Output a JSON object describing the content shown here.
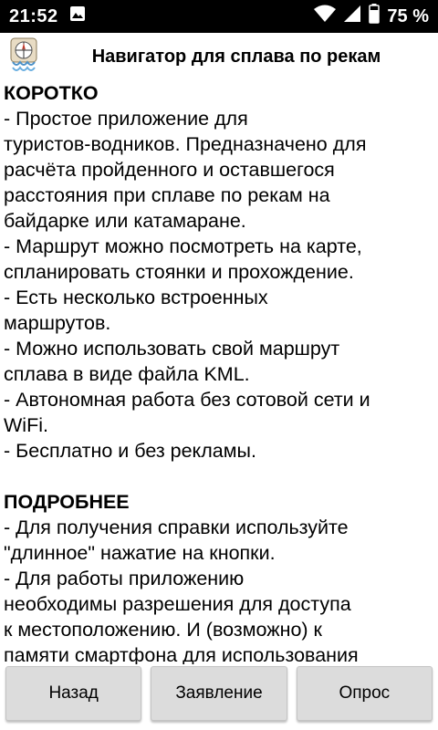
{
  "status_bar": {
    "time": "21:52",
    "battery_percent": "75 %",
    "icons": [
      "image-icon",
      "wifi-icon",
      "signal-icon",
      "battery-icon"
    ]
  },
  "header": {
    "title": "Навигатор для сплава по рекам",
    "logo": "app-logo-icon"
  },
  "content": {
    "short_title": "КОРОТКО",
    "short_lines": [
      "- Простое приложение для",
      "туристов-водников. Предназначено для",
      "расчёта пройденного и оставшегося",
      "расстояния при сплаве по рекам на",
      "байдарке или катамаране.",
      "- Маршрут можно посмотреть на карте,",
      "спланировать стоянки и прохождение.",
      "- Есть несколько встроенных",
      "маршрутов.",
      "- Можно использовать свой маршрут",
      "сплава в виде файла KML.",
      "- Автономная работа без сотовой сети и",
      "WiFi.",
      "- Бесплатно и без рекламы."
    ],
    "detail_title": "ПОДРОБНЕЕ",
    "detail_lines": [
      "- Для получения справки используйте",
      "\"длинное\" нажатие на кнопки.",
      "- Для работы приложению",
      "необходимы разрешения для доступа",
      "к местоположению. И (возможно) к",
      "памяти смартфона для использования"
    ]
  },
  "buttons": {
    "back": "Назад",
    "statement": "Заявление",
    "survey": "Опрос"
  },
  "colors": {
    "status_bar_bg": "#000000",
    "button_bg": "#dcdcdc"
  }
}
